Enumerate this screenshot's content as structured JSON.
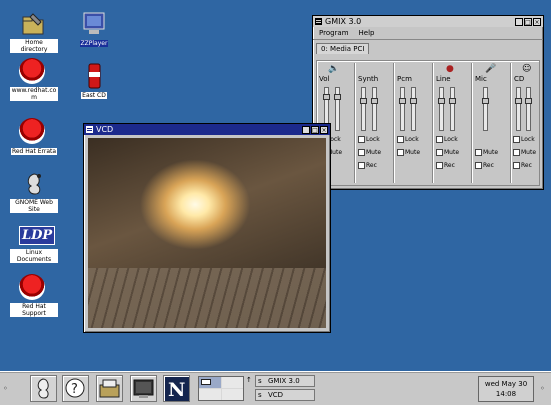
{
  "desktop": {
    "icons": [
      {
        "label": "Home directory"
      },
      {
        "label": "www.redhat.com"
      },
      {
        "label": "Red Hat Errata"
      },
      {
        "label": "GNOME Web Site"
      },
      {
        "label": "Linux Documents"
      },
      {
        "label": "Red Hat Support"
      },
      {
        "label": "ZZPlayer"
      },
      {
        "label": "East CD"
      }
    ],
    "ldp_text": "LDP"
  },
  "mixer": {
    "title": "GMIX 3.0",
    "menu": [
      "Program",
      "Help"
    ],
    "tab": "0: Media PCI",
    "channels": [
      {
        "name": "Vol",
        "icon": "speaker-icon",
        "lock": "Lock",
        "mute": "Mute",
        "rec": ""
      },
      {
        "name": "Synth",
        "icon": "",
        "lock": "Lock",
        "mute": "Mute",
        "rec": "Rec"
      },
      {
        "name": "Pcm",
        "icon": "",
        "lock": "Lock",
        "mute": "Mute",
        "rec": ""
      },
      {
        "name": "Line",
        "icon": "line-in-icon",
        "lock": "Lock",
        "mute": "Mute",
        "rec": "Rec"
      },
      {
        "name": "Mic",
        "icon": "microphone-icon",
        "lock": "",
        "mute": "Mute",
        "rec": "Rec"
      },
      {
        "name": "CD",
        "icon": "cd-icon",
        "lock": "Lock",
        "mute": "Mute",
        "rec": "Rec"
      }
    ]
  },
  "vcd": {
    "title": "VCD"
  },
  "panel": {
    "tasks": [
      {
        "label": "GMIX 3.0"
      },
      {
        "label": "VCD"
      }
    ],
    "clock_day": "wed May 30",
    "clock_time": "14:08"
  },
  "colors": {
    "desktop": "#2f66a3",
    "titlebar_active": "#1c2a8c"
  }
}
